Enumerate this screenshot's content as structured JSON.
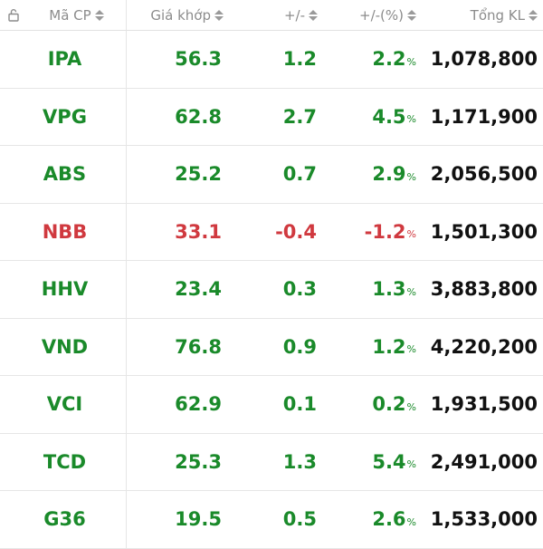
{
  "colors": {
    "up": "#1a8a2a",
    "down": "#d0393f",
    "volume": "#111111",
    "header_text": "#8c8c8c"
  },
  "header": {
    "lock_icon": "lock-icon",
    "code": "Mã CP",
    "price": "Giá khớp",
    "change": "+/-",
    "percent": "+/-(%)",
    "volume": "Tổng KL"
  },
  "rows": [
    {
      "code": "IPA",
      "price": "56.3",
      "change": "1.2",
      "percent": "2.2",
      "volume": "1,078,800",
      "trend": "up"
    },
    {
      "code": "VPG",
      "price": "62.8",
      "change": "2.7",
      "percent": "4.5",
      "volume": "1,171,900",
      "trend": "up"
    },
    {
      "code": "ABS",
      "price": "25.2",
      "change": "0.7",
      "percent": "2.9",
      "volume": "2,056,500",
      "trend": "up"
    },
    {
      "code": "NBB",
      "price": "33.1",
      "change": "-0.4",
      "percent": "-1.2",
      "volume": "1,501,300",
      "trend": "down"
    },
    {
      "code": "HHV",
      "price": "23.4",
      "change": "0.3",
      "percent": "1.3",
      "volume": "3,883,800",
      "trend": "up"
    },
    {
      "code": "VND",
      "price": "76.8",
      "change": "0.9",
      "percent": "1.2",
      "volume": "4,220,200",
      "trend": "up"
    },
    {
      "code": "VCI",
      "price": "62.9",
      "change": "0.1",
      "percent": "0.2",
      "volume": "1,931,500",
      "trend": "up"
    },
    {
      "code": "TCD",
      "price": "25.3",
      "change": "1.3",
      "percent": "5.4",
      "volume": "2,491,000",
      "trend": "up"
    },
    {
      "code": "G36",
      "price": "19.5",
      "change": "0.5",
      "percent": "2.6",
      "volume": "1,533,000",
      "trend": "up"
    }
  ],
  "percent_sign": "%"
}
